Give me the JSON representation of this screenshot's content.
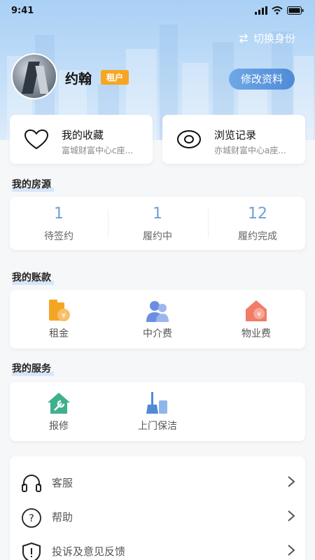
{
  "status": {
    "time": "9:41"
  },
  "header": {
    "switch_label": "切换身份"
  },
  "profile": {
    "name": "约翰",
    "role_badge": "租户",
    "edit_label": "修改资料"
  },
  "quick_cards": [
    {
      "title": "我的收藏",
      "subtitle": "富城财富中心c座...",
      "icon": "heart-icon"
    },
    {
      "title": "浏览记录",
      "subtitle": "亦城财富中心a座...",
      "icon": "eye-icon"
    }
  ],
  "housing": {
    "title": "我的房源",
    "stats": [
      {
        "value": "1",
        "label": "待签约"
      },
      {
        "value": "1",
        "label": "履约中"
      },
      {
        "value": "12",
        "label": "履约完成"
      }
    ]
  },
  "billing": {
    "title": "我的账款",
    "items": [
      {
        "label": "租金",
        "icon": "rent-icon"
      },
      {
        "label": "中介费",
        "icon": "agency-fee-icon"
      },
      {
        "label": "物业费",
        "icon": "property-fee-icon"
      }
    ]
  },
  "services": {
    "title": "我的服务",
    "items": [
      {
        "label": "报修",
        "icon": "repair-icon"
      },
      {
        "label": "上门保洁",
        "icon": "cleaning-icon"
      }
    ]
  },
  "menu": [
    {
      "label": "客服",
      "icon": "headset-icon"
    },
    {
      "label": "帮助",
      "icon": "help-icon"
    },
    {
      "label": "投诉及意见反馈",
      "icon": "shield-icon"
    }
  ],
  "colors": {
    "accent": "#4f8bd7",
    "badge": "#f6a623",
    "stat_number": "#6fa0d8"
  }
}
